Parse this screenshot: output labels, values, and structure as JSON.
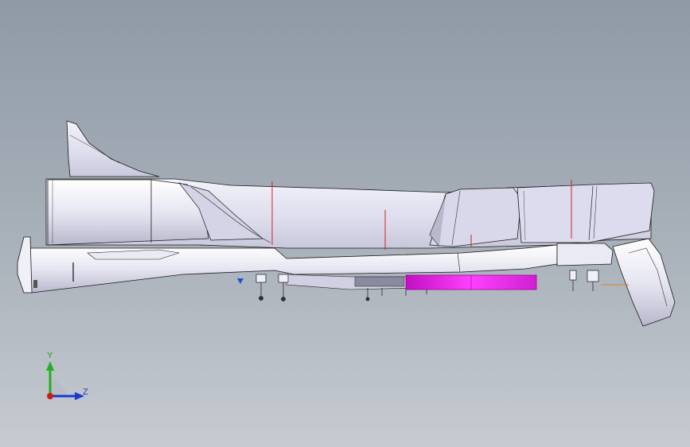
{
  "viewport": {
    "background_top": "#8f9aa6",
    "background_bottom": "#c6cbd1"
  },
  "model": {
    "body_color": "#e8e8f4",
    "edge_color": "#1a1a1a",
    "highlight_color": "#e010e0",
    "reference_line_color": "#d02020"
  },
  "triad": {
    "y_label": "Y",
    "z_label": "Z",
    "y_color": "#22b020",
    "z_color": "#1a3ad0",
    "x_color": "#d01818"
  }
}
